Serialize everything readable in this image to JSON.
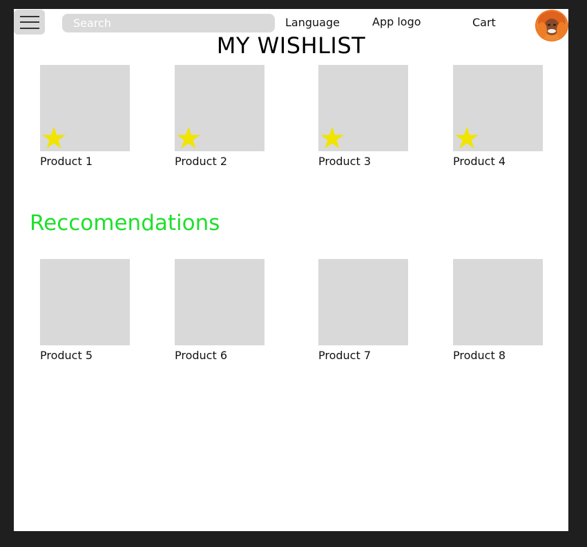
{
  "header": {
    "search_placeholder": "Search",
    "language_label": "Language",
    "app_logo_label": "App logo",
    "cart_label": "Cart"
  },
  "page_title": "MY WISHLIST",
  "wishlist": {
    "items": [
      {
        "name": "Product 1",
        "favorited": true
      },
      {
        "name": "Product 2",
        "favorited": true
      },
      {
        "name": "Product 3",
        "favorited": true
      },
      {
        "name": "Product 4",
        "favorited": true
      }
    ]
  },
  "recommendations": {
    "heading": "Reccomendations",
    "items": [
      {
        "name": "Product 5"
      },
      {
        "name": "Product 6"
      },
      {
        "name": "Product 7"
      },
      {
        "name": "Product 8"
      }
    ]
  },
  "colors": {
    "page_background": "#1f1f1f",
    "content_background": "#ffffff",
    "placeholder_gray": "#d9d9d9",
    "star_yellow": "#f0e400",
    "heading_green": "#1ee02a"
  },
  "icons": {
    "menu": "hamburger-menu-icon",
    "favorite": "star-icon",
    "profile": "avatar"
  }
}
